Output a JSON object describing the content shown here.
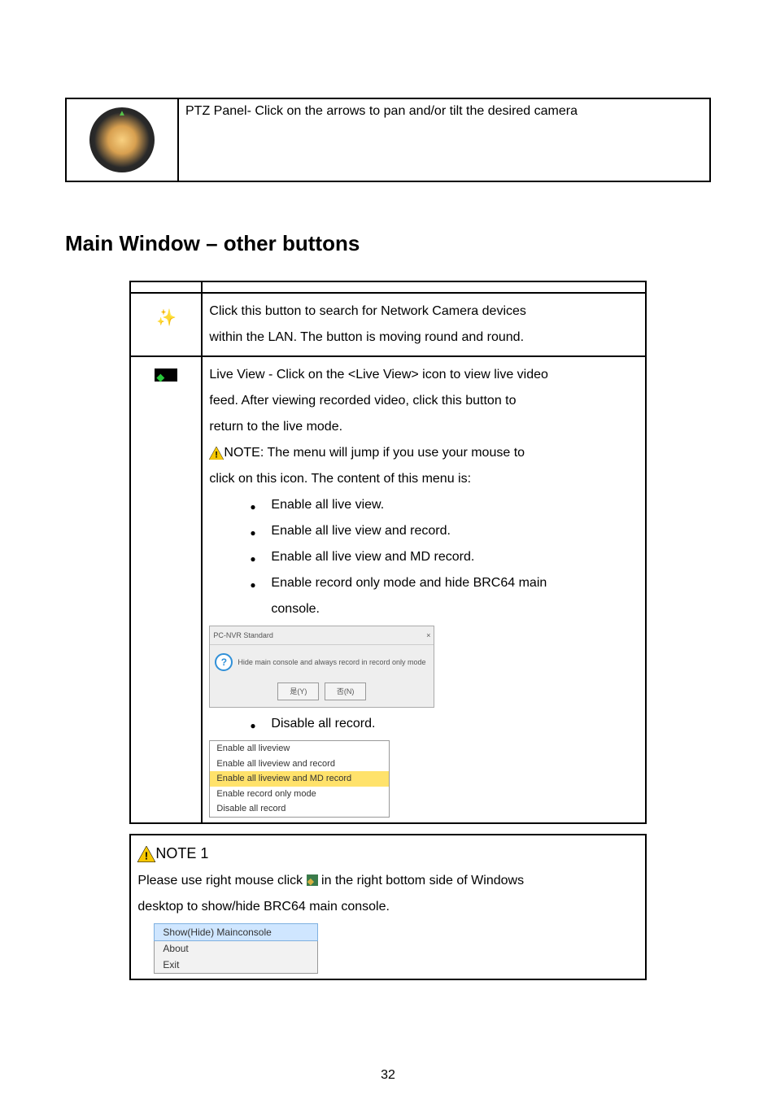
{
  "ptz_row": {
    "desc": "PTZ Panel- Click on the arrows to pan and/or tilt the desired camera"
  },
  "heading": "Main Window – other buttons",
  "row1": {
    "l1": "Click this button to search for Network Camera devices",
    "l2": "within the LAN. The button is moving round and round."
  },
  "row2": {
    "l1": "Live View - Click on the <Live View> icon to view live video",
    "l2": "feed. After viewing recorded video, click this button to",
    "l3": "return to the live mode.",
    "note_prefix": "NOTE: ",
    "note_rest": "The menu will jump if you use your mouse to",
    "l5": "click on this icon. The content of this menu is:",
    "b1": "Enable all live view.",
    "b2": "Enable all live view and record.",
    "b3": "Enable all live view and MD record.",
    "b4": "Enable record only mode and hide BRC64 main",
    "b4b": "console.",
    "b5": "Disable all record."
  },
  "dialog": {
    "title": "PC-NVR Standard",
    "close": "×",
    "msg": "Hide main console and always record in record only mode",
    "btn_yes": "是(Y)",
    "btn_no": "否(N)"
  },
  "menu": {
    "i1": "Enable all liveview",
    "i2": "Enable all liveview and record",
    "i3": "Enable all liveview and MD record",
    "i4": "Enable record only mode",
    "i5": "Disable all record"
  },
  "note1": {
    "title": "NOTE 1",
    "l1a": "Please use right mouse click ",
    "l1b": " in the right bottom side of Windows",
    "l2": "desktop to show/hide BRC64 main console."
  },
  "ctx": {
    "i1": "Show(Hide) Mainconsole",
    "i2": "About",
    "i3": "Exit"
  },
  "page_number": "32"
}
